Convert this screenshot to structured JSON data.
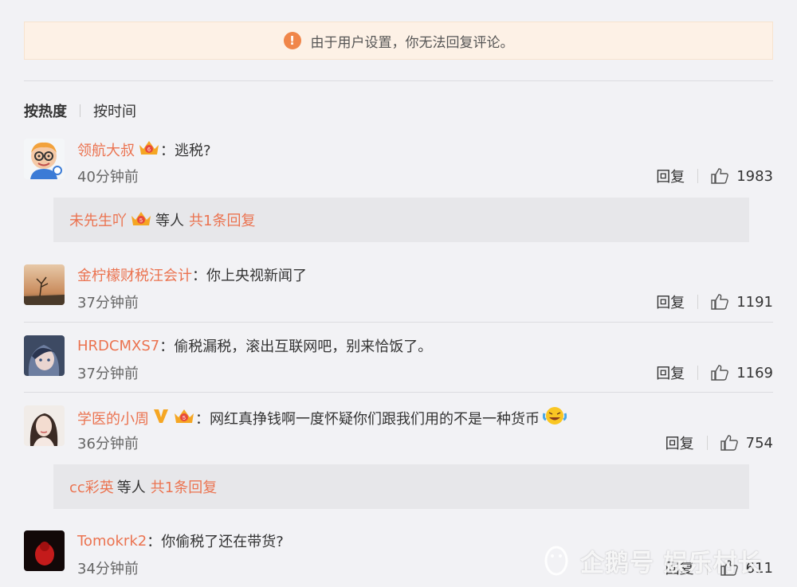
{
  "notice": {
    "icon": "warning-icon",
    "text": "由于用户设置，你无法回复评论。",
    "accent": "#f0864a"
  },
  "sort": {
    "hot": "按热度",
    "time": "按时间"
  },
  "actions": {
    "reply": "回复"
  },
  "colon": "：",
  "comments": [
    {
      "user": "领航大叔",
      "text": "逃税?",
      "time": "40分钟前",
      "likes": "1983",
      "sub": {
        "user": "未先生吖",
        "mid": "等人",
        "more": "共1条回复"
      }
    },
    {
      "user": "金柠檬财税汪会计",
      "text": "你上央视新闻了",
      "time": "37分钟前",
      "likes": "1191"
    },
    {
      "user": "HRDCMXS7",
      "text": "偷税漏税，滚出互联网吧，别来恰饭了。",
      "time": "37分钟前",
      "likes": "1169"
    },
    {
      "user": "学医的小周",
      "text": "网红真挣钱啊一度怀疑你们跟我们用的不是一种货币",
      "time": "36分钟前",
      "likes": "754",
      "sub": {
        "user": "cc彩英",
        "mid": "等人",
        "more": "共1条回复"
      }
    },
    {
      "user": "Tomokrk2",
      "text": "你偷税了还在带货?",
      "time": "34分钟前",
      "likes": "611"
    }
  ],
  "watermark": "企鹅号 娱乐村长",
  "colors": {
    "username": "#eb7350",
    "background": "#f2f2f5",
    "subbox": "#e7e7ea"
  }
}
